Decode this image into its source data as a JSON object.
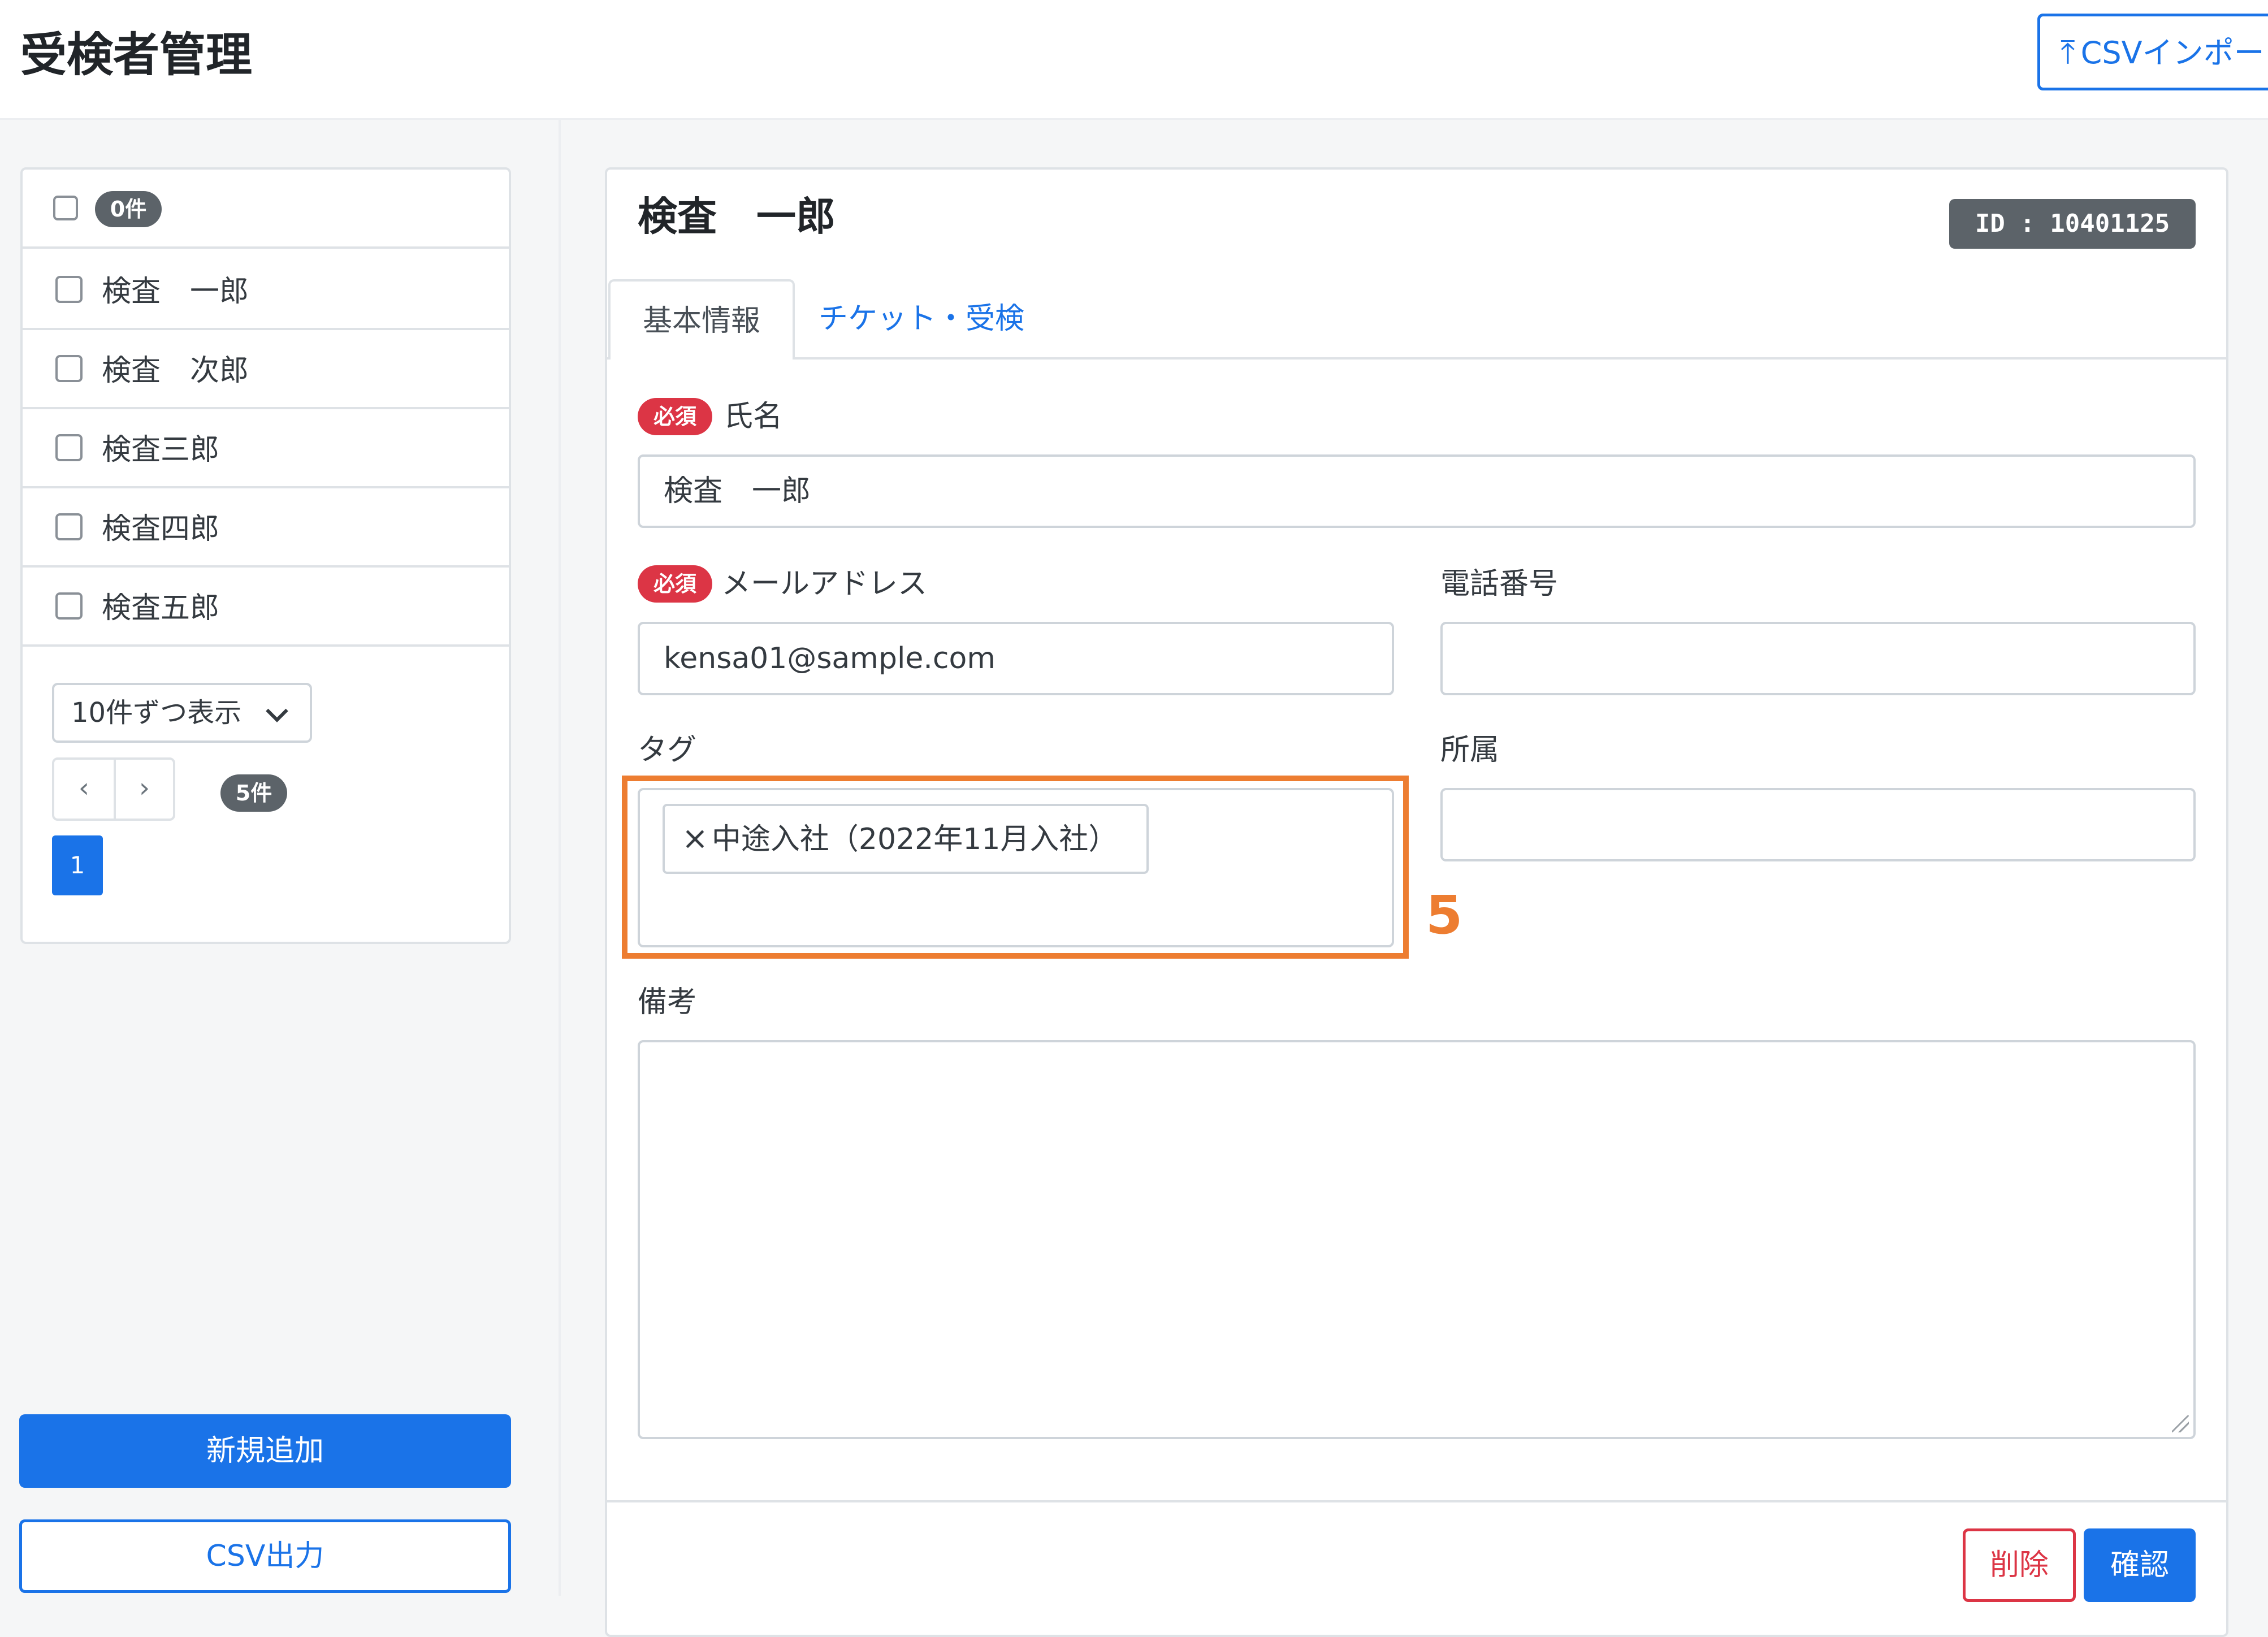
{
  "header": {
    "title": "受検者管理",
    "csv_import_label": "CSVインポート",
    "csv_import_icon": "upload-icon"
  },
  "list": {
    "selected_count": "0件",
    "items": [
      {
        "name": "検査　一郎"
      },
      {
        "name": "検査　次郎"
      },
      {
        "name": "検査三郎"
      },
      {
        "name": "検査四郎"
      },
      {
        "name": "検査五郎"
      }
    ],
    "page_size": "10件ずつ表示",
    "prev": "‹",
    "next": "›",
    "total_count": "5件",
    "current_page": "1"
  },
  "sidebar_actions": {
    "add_label": "新規追加",
    "export_label": "CSV出力"
  },
  "detail": {
    "title": "検査　一郎",
    "id_label": "ID : 10401125",
    "tabs": [
      {
        "label": "基本情報",
        "active": true
      },
      {
        "label": "チケット・受検",
        "active": false
      }
    ],
    "required_badge": "必須",
    "fields": {
      "name": {
        "label": "氏名",
        "value": "検査　一郎"
      },
      "email": {
        "label": "メールアドレス",
        "value": "kensa01@sample.com"
      },
      "phone": {
        "label": "電話番号",
        "value": ""
      },
      "tags": {
        "label": "タグ",
        "chips": [
          "中途入社（2022年11月入社）"
        ]
      },
      "affiliation": {
        "label": "所属",
        "value": ""
      },
      "notes": {
        "label": "備考",
        "value": ""
      }
    },
    "delete_label": "削除",
    "confirm_label": "確認"
  },
  "annotation": {
    "callout_number": "5",
    "highlight_color": "#ed7d31"
  },
  "colors": {
    "primary": "#1a73e8",
    "danger": "#dc3545",
    "badge_gray": "#5c6369"
  }
}
